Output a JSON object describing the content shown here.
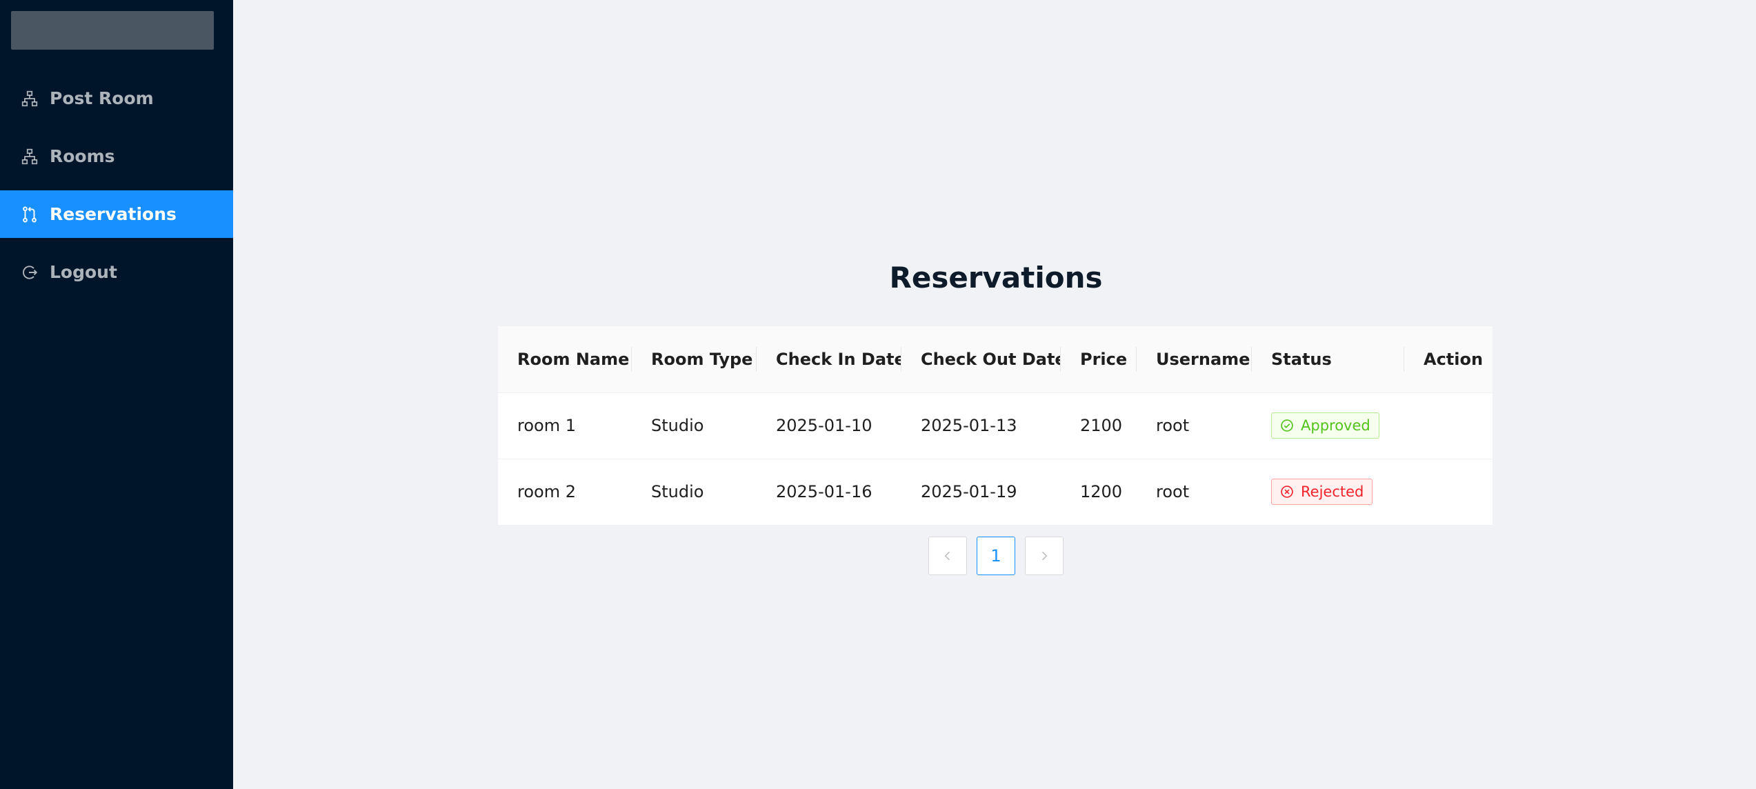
{
  "sidebar": {
    "items": [
      {
        "label": "Post Room",
        "icon": "cluster-icon",
        "active": false
      },
      {
        "label": "Rooms",
        "icon": "cluster-icon",
        "active": false
      },
      {
        "label": "Reservations",
        "icon": "pull-request-icon",
        "active": true
      },
      {
        "label": "Logout",
        "icon": "logout-icon",
        "active": false
      }
    ]
  },
  "main": {
    "title": "Reservations",
    "table": {
      "columns": [
        "Room Name",
        "Room Type",
        "Check In Date",
        "Check Out Date",
        "Price",
        "Username",
        "Status",
        "Action"
      ],
      "rows": [
        {
          "room_name": "room 1",
          "room_type": "Studio",
          "check_in": "2025-01-10",
          "check_out": "2025-01-13",
          "price": "2100",
          "username": "root",
          "status": "Approved"
        },
        {
          "room_name": "room 2",
          "room_type": "Studio",
          "check_in": "2025-01-16",
          "check_out": "2025-01-19",
          "price": "1200",
          "username": "root",
          "status": "Rejected"
        }
      ]
    },
    "pagination": {
      "current_page": "1"
    }
  },
  "colors": {
    "sidebar_bg": "#001529",
    "active_item": "#1890ff",
    "approved": "#52c41a",
    "rejected": "#f5222d"
  }
}
